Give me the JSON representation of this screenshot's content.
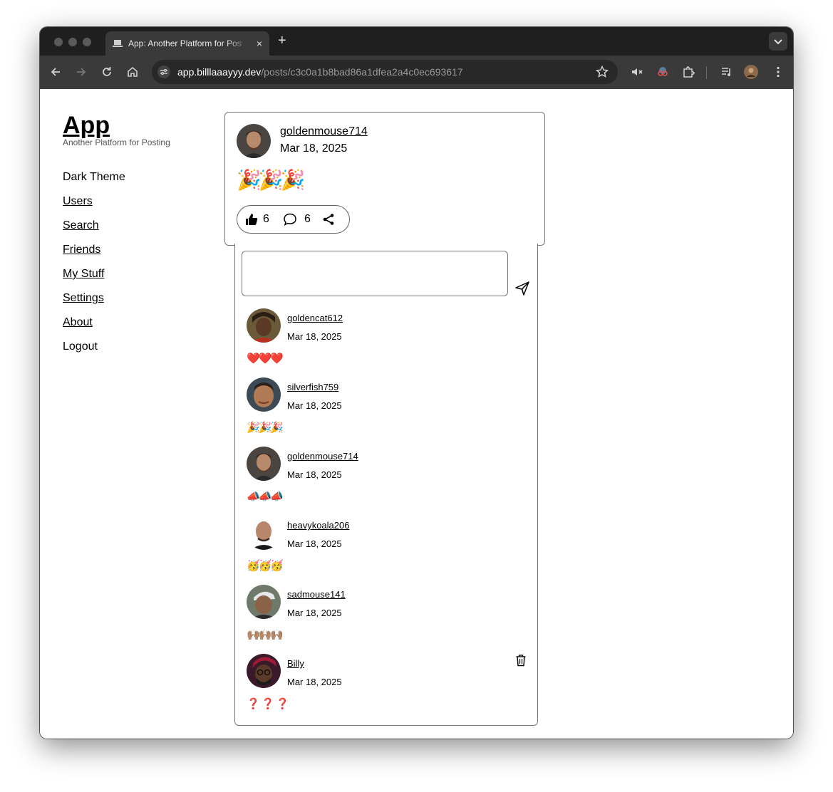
{
  "browser": {
    "tab_title": "App: Another Platform for Posting",
    "tab_close": "×",
    "new_tab": "+",
    "url_host": "app.billlaaayyy.dev",
    "url_path": "/posts/c3c0a1b8bad86a1dfea2a4c0ec693617"
  },
  "app": {
    "title": "App",
    "subtitle": "Another Platform for Posting"
  },
  "nav": {
    "dark_theme": "Dark Theme",
    "users": "Users",
    "search": "Search",
    "friends": "Friends",
    "my_stuff": "My Stuff",
    "settings": "Settings",
    "about": "About",
    "logout": "Logout"
  },
  "post": {
    "username": "goldenmouse714",
    "date": "Mar 18, 2025",
    "body": "🎉🎉🎉",
    "likes": "6",
    "comments": "6"
  },
  "reply": {
    "value": ""
  },
  "comments": [
    {
      "username": "goldencat612",
      "date": "Mar 18, 2025",
      "body": "❤️❤️❤️"
    },
    {
      "username": "silverfish759",
      "date": "Mar 18, 2025",
      "body": "🎉🎉🎉"
    },
    {
      "username": "goldenmouse714",
      "date": "Mar 18, 2025",
      "body": "📣📣📣"
    },
    {
      "username": "heavykoala206",
      "date": "Mar 18, 2025",
      "body": "🥳🥳🥳"
    },
    {
      "username": "sadmouse141",
      "date": "Mar 18, 2025",
      "body": "🙌🏽🙌🏽🙌🏽"
    },
    {
      "username": "Billy",
      "date": "Mar 18, 2025",
      "body": "❓❓❓"
    }
  ],
  "colors": {
    "tab_strip": "#1f1f1f",
    "toolbar": "#3a3a3a",
    "accent_question": "#d0191f"
  }
}
